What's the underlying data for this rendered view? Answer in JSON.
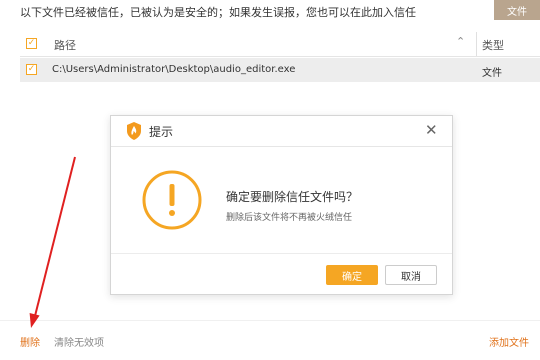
{
  "header": {
    "info_text": "以下文件已经被信任，已被认为是安全的；如果发生误报，您也可以在此加入信任",
    "top_button_label": "文件"
  },
  "table": {
    "columns": {
      "path": "路径",
      "type": "类型"
    },
    "rows": [
      {
        "path": "C:\\Users\\Administrator\\Desktop\\audio_editor.exe",
        "type": "文件",
        "checked": true
      }
    ]
  },
  "dialog": {
    "title": "提示",
    "message": "确定要删除信任文件吗？",
    "submessage": "删除后该文件将不再被火绒信任",
    "confirm_label": "确定",
    "cancel_label": "取消"
  },
  "bottom": {
    "delete_label": "删除",
    "clear_label": "清除无效项",
    "add_label": "添加文件"
  },
  "colors": {
    "accent": "#f5a623",
    "link_orange": "#e0721b",
    "annotation_arrow": "#e02020"
  }
}
